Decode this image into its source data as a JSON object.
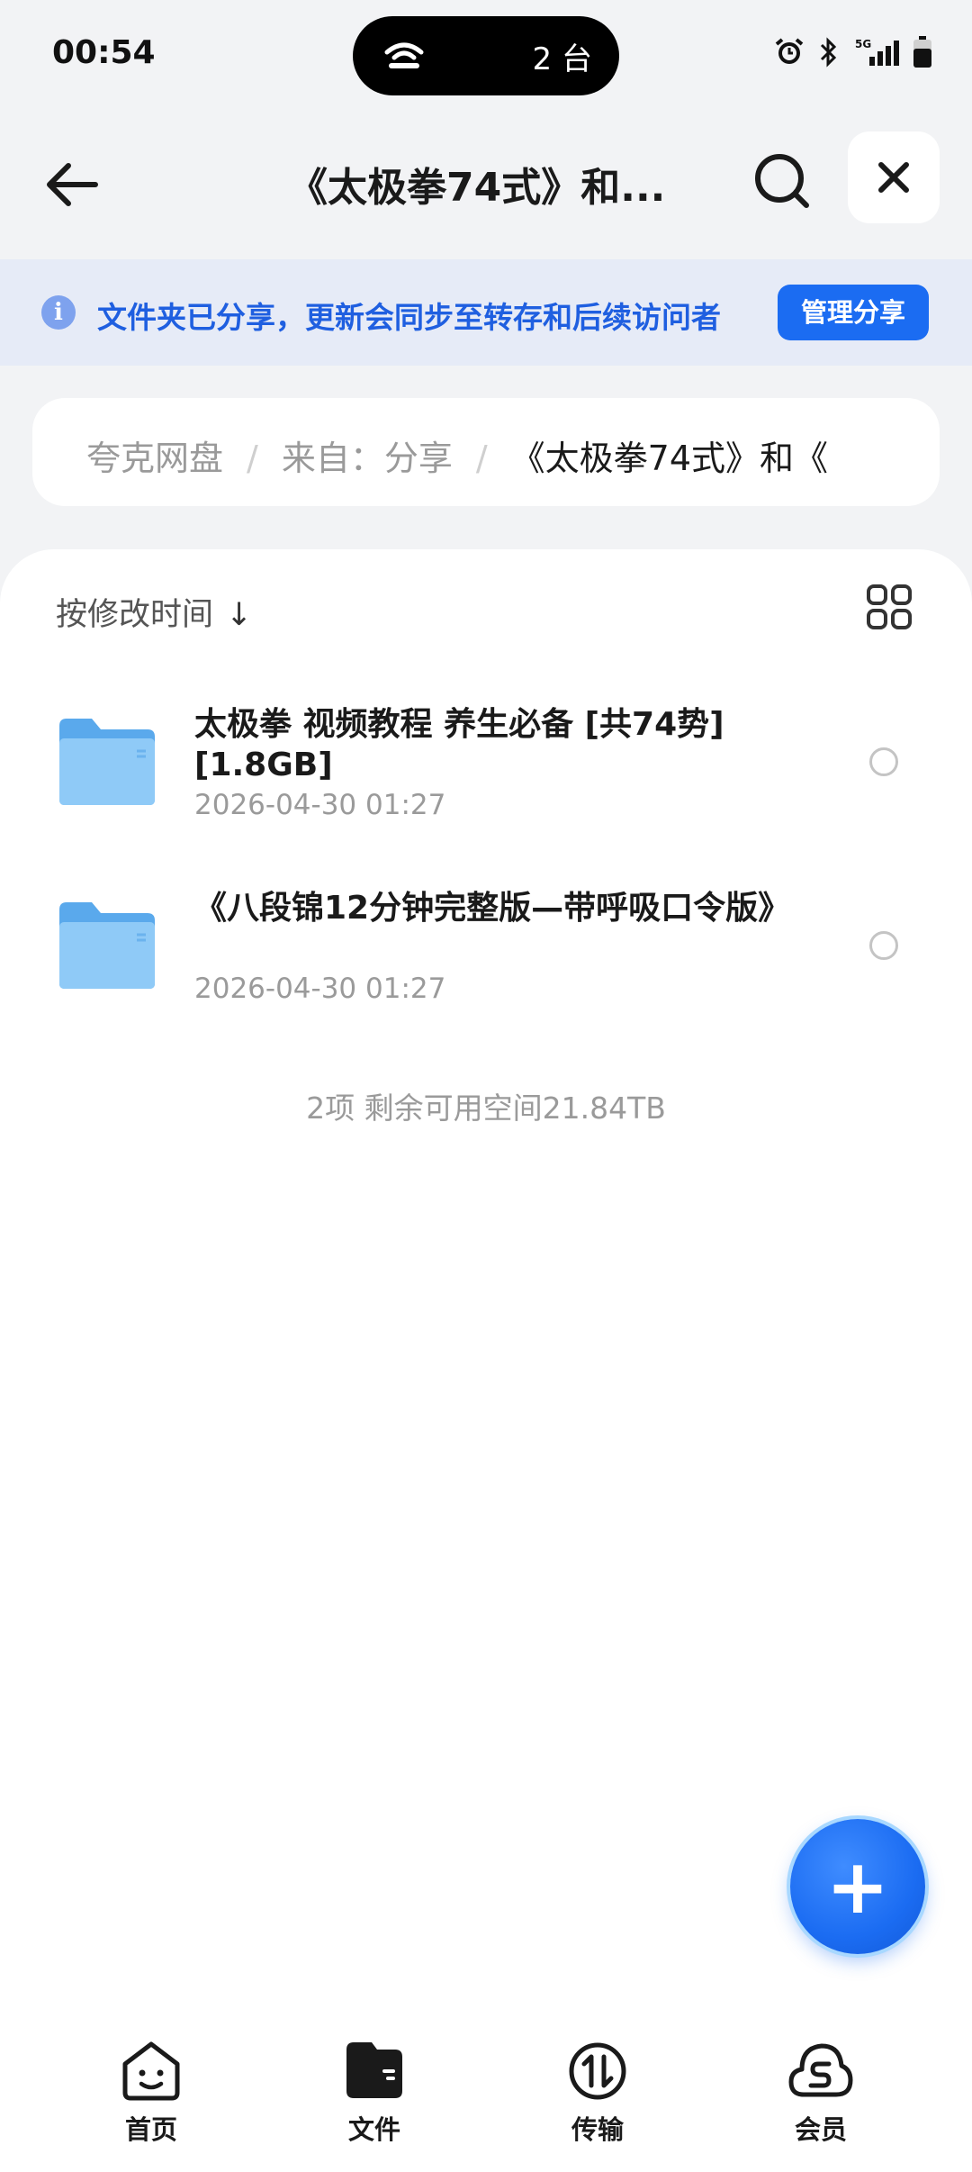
{
  "status_bar": {
    "time": "00:54",
    "island_text": "2 台"
  },
  "header": {
    "title": "《太极拳74式》和..."
  },
  "banner": {
    "text": "文件夹已分享，更新会同步至转存和后续访问者",
    "manage_label": "管理分享"
  },
  "breadcrumb": {
    "items": [
      "夸克网盘",
      "来自：分享",
      "《太极拳74式》和《"
    ],
    "separator": "/"
  },
  "list": {
    "sort_label": "按修改时间",
    "sort_arrow": "↓",
    "files": [
      {
        "name": "太极拳 视频教程 养生必备 [共74势] [1.8GB]",
        "date": "2026-04-30 01:27"
      },
      {
        "name": "《八段锦12分钟完整版—带呼吸口令版》",
        "date": "2026-04-30 01:27"
      }
    ],
    "summary": "2项 剩余可用空间21.84TB"
  },
  "fab": {
    "label": "+"
  },
  "nav": {
    "items": [
      {
        "label": "首页",
        "icon": "home-face-icon"
      },
      {
        "label": "文件",
        "icon": "folder-wallet-icon"
      },
      {
        "label": "传输",
        "icon": "transfer-icon"
      },
      {
        "label": "会员",
        "icon": "cloud-member-icon"
      }
    ]
  },
  "colors": {
    "accent": "#1b6cf2",
    "banner_bg": "#e6ebf7",
    "page_bg": "#f2f3f5"
  }
}
